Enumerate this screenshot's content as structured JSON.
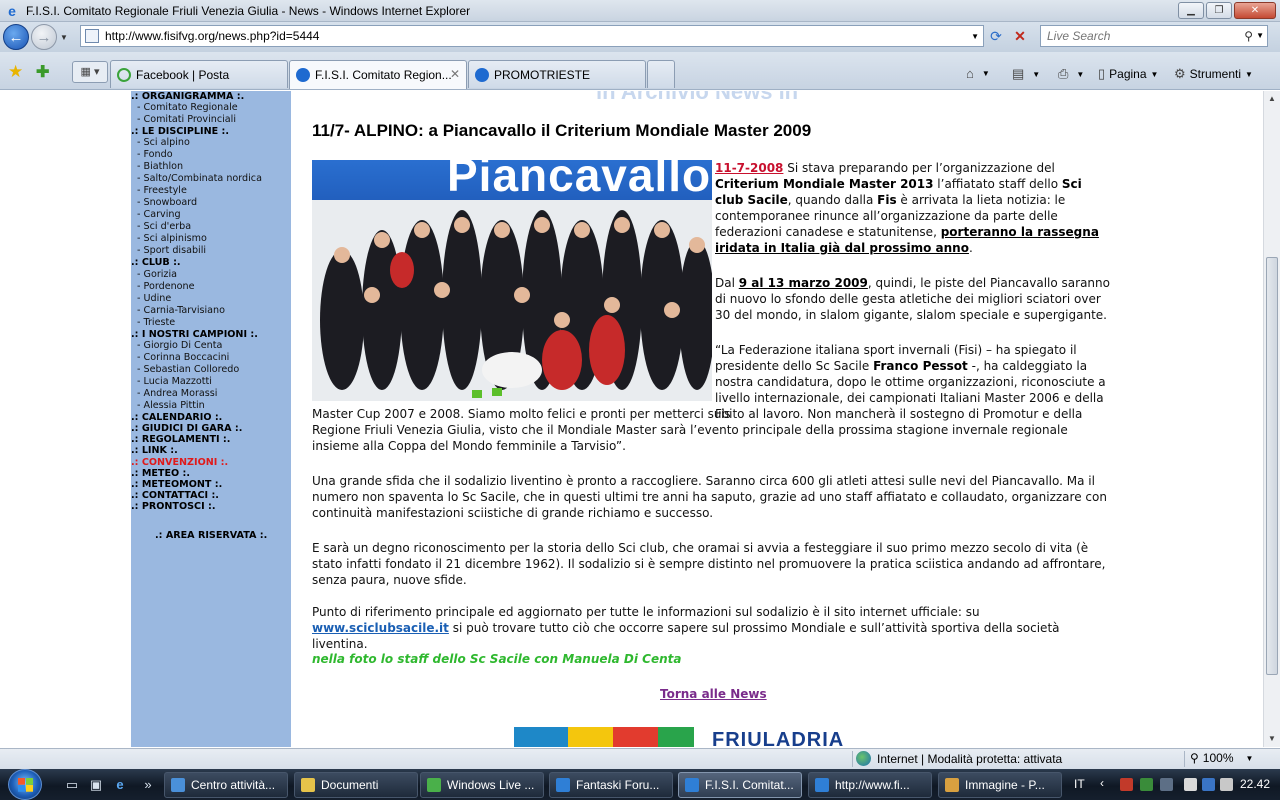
{
  "window": {
    "title": "F.I.S.I. Comitato Regionale Friuli Venezia Giulia - News - Windows Internet Explorer"
  },
  "address": {
    "url": "http://www.fisifvg.org/news.php?id=5444",
    "search_placeholder": "Live Search"
  },
  "tabs": [
    {
      "label": "Facebook | Posta",
      "icon_color": "#3aa33a"
    },
    {
      "label": "F.I.S.I. Comitato Region...",
      "icon_color": "#1e6ad0"
    },
    {
      "label": "PROMOTRIESTE",
      "icon_color": "#1e6ad0"
    }
  ],
  "commands": {
    "pagina": "Pagina",
    "strumenti": "Strumenti"
  },
  "sidebar": {
    "sections": [
      {
        "label": ".: ORGANIGRAMMA :.",
        "items": [
          "- Comitato Regionale",
          "- Comitati Provinciali"
        ]
      },
      {
        "label": ".: LE DISCIPLINE :.",
        "items": [
          "- Sci alpino",
          "- Fondo",
          "- Biathlon",
          "- Salto/Combinata nordica",
          "- Freestyle",
          "- Snowboard",
          "- Carving",
          "- Sci d'erba",
          "- Sci alpinismo",
          "- Sport disabili"
        ]
      },
      {
        "label": ".: CLUB :.",
        "items": [
          "- Gorizia",
          "- Pordenone",
          "- Udine",
          "- Carnia-Tarvisiano",
          "- Trieste"
        ]
      },
      {
        "label": ".: I NOSTRI CAMPIONI :.",
        "items": [
          "- Giorgio Di Centa",
          "- Corinna Boccacini",
          "- Sebastian Colloredo",
          "- Lucia Mazzotti",
          "- Andrea Morassi",
          "- Alessia Pittin"
        ]
      }
    ],
    "links": [
      ".: CALENDARIO :.",
      ".: GIUDICI DI GARA :.",
      ".: REGOLAMENTI :.",
      ".: LINK :.",
      ".: CONVENZIONI :.",
      ".: METEO :.",
      ".: METEOMONT :.",
      ".: CONTATTACI :.",
      ".: PRONTOSCI :."
    ],
    "area": ".: AREA RISERVATA :."
  },
  "article": {
    "archive_banner": "ın Archivio News ın",
    "headline": "11/7- ALPINO: a Piancavallo il Criterium Mondiale Master 2009",
    "photo_brand": "Piancavallo",
    "date": "11-7-2008",
    "p1": [
      {
        "t": " Si stava preparando per l’organizzazione del "
      },
      {
        "t": "Criterium Mondiale Master 2013",
        "b": true
      },
      {
        "t": " l’affiatato staff dello "
      },
      {
        "t": "Sci club Sacile",
        "b": true
      },
      {
        "t": ", quando dalla "
      },
      {
        "t": "Fis",
        "b": true
      },
      {
        "t": " è arrivata la lieta notizia: le contemporanee rinunce all’organizzazione da parte delle federazioni canadese e statunitense, "
      },
      {
        "t": "porteranno la rassegna iridata in Italia già dal prossimo anno",
        "u": true
      },
      {
        "t": "."
      }
    ],
    "p2": [
      {
        "t": "Dal "
      },
      {
        "t": "9 al 13 marzo 2009",
        "u": true
      },
      {
        "t": ", quindi, le piste del Piancavallo saranno di nuovo lo sfondo delle gesta atletiche dei migliori sciatori over 30 del mondo, in slalom gigante, slalom speciale e supergigante."
      }
    ],
    "p3_top": [
      {
        "t": "“La Federazione italiana sport invernali (Fisi) – ha spiegato il presidente dello Sc Sacile "
      },
      {
        "t": "Franco Pessot",
        "b": true
      },
      {
        "t": " -, ha caldeggiato la nostra candidatura, dopo le ottime organizzazioni, riconosciute a livello internazionale, dei campionati Italiani Master 2006 e della Fis"
      }
    ],
    "p3_bottom": "Master Cup 2007 e 2008. Siamo molto felici e pronti per metterci subito al lavoro. Non mancherà il sostegno di Promotur e della Regione Friuli Venezia Giulia, visto che il Mondiale Master sarà l’evento principale della prossima stagione invernale regionale insieme alla Coppa del Mondo femminile a Tarvisio”.",
    "p4": "Una grande sfida che il sodalizio liventino è pronto a raccogliere. Saranno circa 600 gli atleti attesi sulle nevi del Piancavallo. Ma il numero non spaventa lo Sc Sacile, che in questi ultimi tre anni ha saputo, grazie ad uno staff affiatato e collaudato, organizzare con continuità manifestazioni sciistiche di grande richiamo e successo.",
    "p5": "E sarà un degno riconoscimento per la storia dello Sci club, che oramai si avvia a festeggiare il suo primo mezzo secolo di vita (è stato infatti fondato il 21 dicembre 1962). Il sodalizio si è sempre distinto nel promuovere la pratica sciistica andando ad affrontare, senza paura, nuove sfide.",
    "p6_pre": "Punto di riferimento principale ed aggiornato per tutte le informazioni sul sodalizio è il sito internet ufficiale: su ",
    "p6_link": "www.sciclubsacile.it",
    "p6_post": " si può trovare tutto ciò che occorre sapere sul prossimo Mondiale e sull’attività sportiva della società liventina.",
    "caption": "nella foto lo staff dello Sc Sacile con Manuela Di Centa",
    "back_link": "Torna alle News",
    "footer_logo_text": "FRIULADRIA"
  },
  "status": {
    "zone": "Internet | Modalità protetta: attivata",
    "zoom": "100%"
  },
  "taskbar": {
    "buttons": [
      {
        "label": "Centro attività...",
        "color": "#4a90d9"
      },
      {
        "label": "Documenti",
        "color": "#e6c34a"
      },
      {
        "label": "Windows Live ...",
        "color": "#4ab04a"
      },
      {
        "label": "Fantaski Foru...",
        "color": "#2f7fd6"
      },
      {
        "label": "F.I.S.I. Comitat...",
        "color": "#2f7fd6"
      },
      {
        "label": "http://www.fi...",
        "color": "#2f7fd6"
      },
      {
        "label": "Immagine - P...",
        "color": "#d8a040"
      }
    ],
    "lang": "IT",
    "clock": "22.42"
  },
  "colors": {
    "sidebar_bg": "#9ab8e0",
    "accent_red": "#c8102e",
    "link_blue": "#1a5fb4",
    "caption_green": "#2fb82f",
    "visited_purple": "#7a2b8b"
  }
}
